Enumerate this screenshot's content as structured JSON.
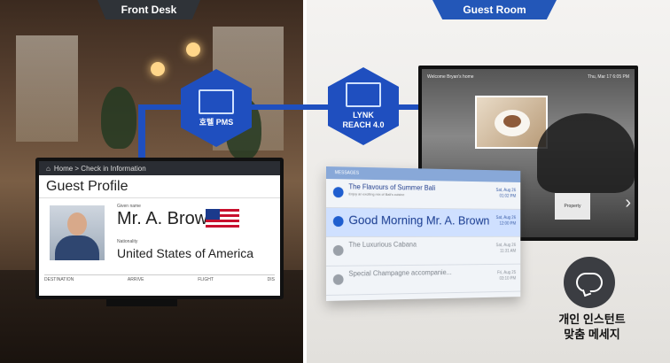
{
  "front_desk": {
    "header": "Front Desk",
    "breadcrumb": "Home > Check in Information",
    "profile_title": "Guest Profile",
    "given_name_label": "Given name",
    "guest_name": "Mr. A. Brown",
    "nationality_label": "Nationality",
    "nationality": "United States of America",
    "columns": [
      "DESTINATION",
      "ARRIVE",
      "FLIGHT",
      "DIS"
    ]
  },
  "hexagons": {
    "pms_label": "호텔 PMS",
    "lynk_label_line1": "LYNK",
    "lynk_label_line2": "REACH 4.0"
  },
  "guest_room": {
    "header": "Guest Room",
    "tv_welcome": "Welcome Bryan's home",
    "tv_clock": "Thu, Mar 17 6:05 PM",
    "messages_bar": "MESSAGES",
    "messages": [
      {
        "title": "The Flavours of Summer Bali",
        "subtitle": "Enjoy an exciting mix of Bali's cuisine",
        "date_line1": "Sat, Aug 26",
        "date_line2": "01:02 PM",
        "state": "normal"
      },
      {
        "title": "Good Morning Mr. A. Brown",
        "subtitle": "",
        "date_line1": "Sat, Aug 26",
        "date_line2": "12:00 PM",
        "state": "active"
      },
      {
        "title": "The Luxurious Cabana",
        "subtitle": "",
        "date_line1": "Sat, Aug 26",
        "date_line2": "11:31 AM",
        "state": "faded"
      },
      {
        "title": "Special Champagne accompanie...",
        "subtitle": "",
        "date_line1": "Fri, Aug 25",
        "date_line2": "03:10 PM",
        "state": "faded"
      }
    ],
    "tile_label": "Property"
  },
  "caption_line1": "개인 인스턴트",
  "caption_line2": "맞춤 메세지",
  "colors": {
    "accent": "#1f4fbf",
    "dark_tab": "#2f3338"
  }
}
